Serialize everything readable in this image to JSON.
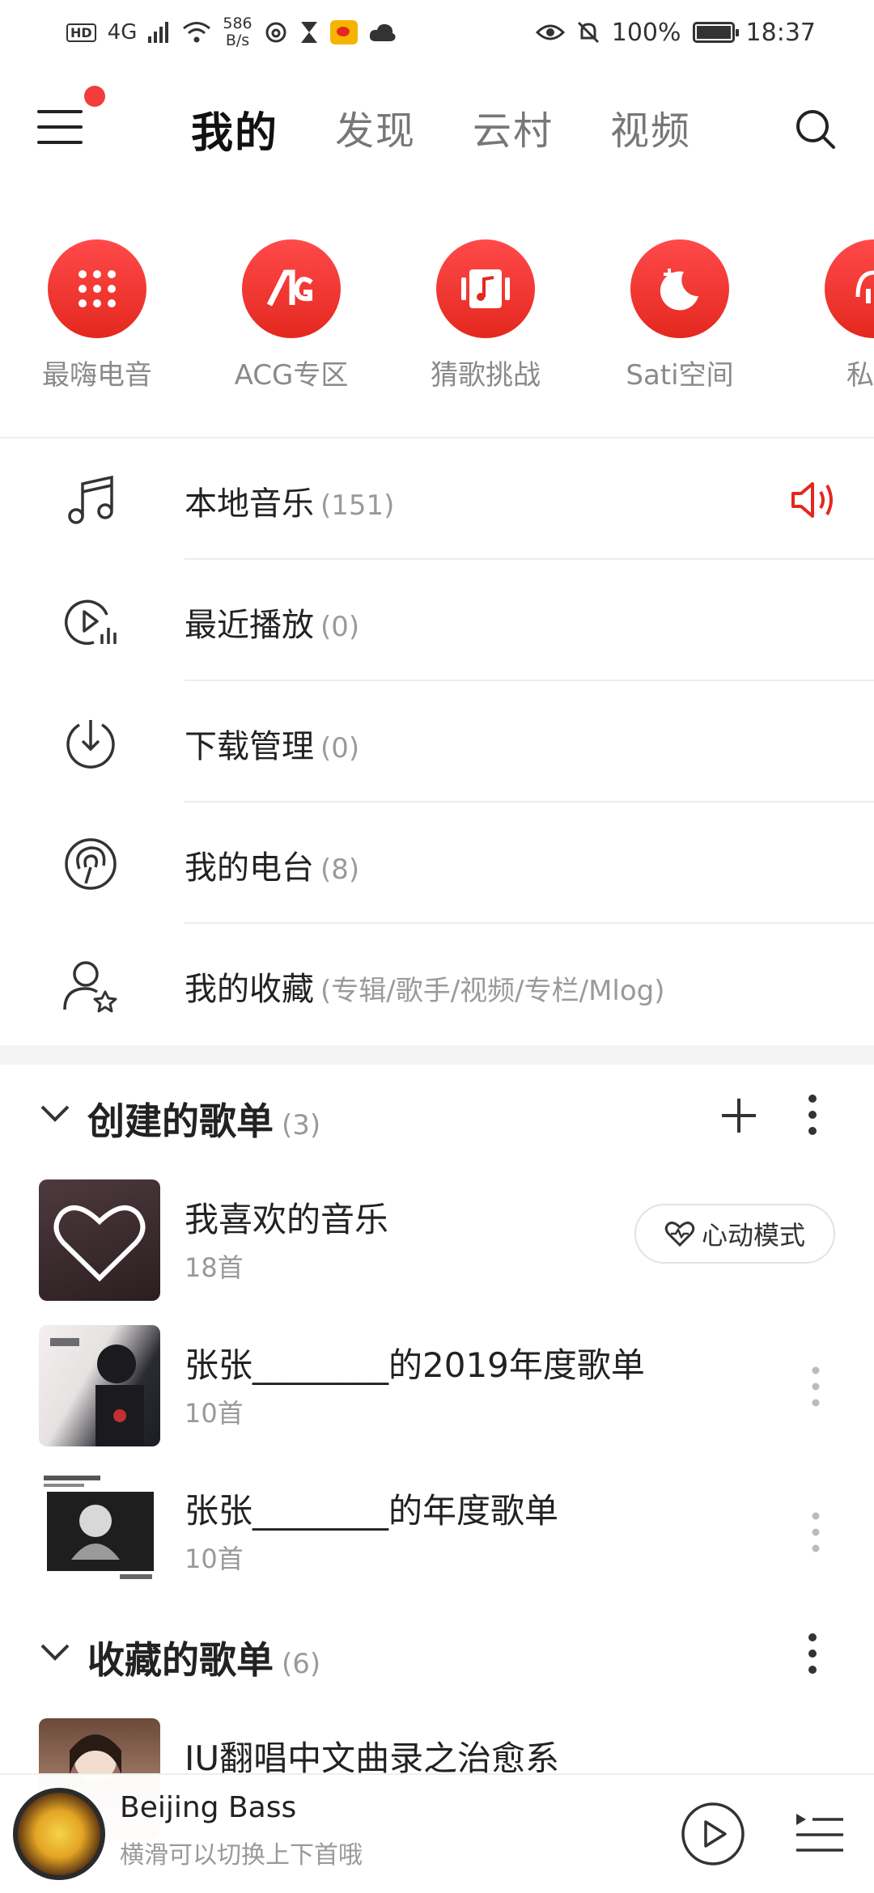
{
  "status_bar": {
    "network": "4G",
    "speed_value": "586",
    "speed_unit": "B/s",
    "battery": "100%",
    "battery_level": 1.0,
    "time": "18:37"
  },
  "nav": {
    "tabs": [
      {
        "label": "我的",
        "active": true
      },
      {
        "label": "发现",
        "active": false
      },
      {
        "label": "云村",
        "active": false
      },
      {
        "label": "视频",
        "active": false
      }
    ]
  },
  "quick_entries": [
    {
      "label": "最嗨电音",
      "icon": "dots-grid-icon"
    },
    {
      "label": "ACG专区",
      "icon": "acg-logo-icon"
    },
    {
      "label": "猜歌挑战",
      "icon": "music-card-icon"
    },
    {
      "label": "Sati空间",
      "icon": "moon-icon"
    },
    {
      "label": "私藏",
      "icon": "private-radio-icon"
    }
  ],
  "library": [
    {
      "label": "本地音乐",
      "count": "(151)",
      "icon": "music-note-icon"
    },
    {
      "label": "最近播放",
      "count": "(0)",
      "icon": "recent-play-icon"
    },
    {
      "label": "下载管理",
      "count": "(0)",
      "icon": "download-icon"
    },
    {
      "label": "我的电台",
      "count": "(8)",
      "icon": "radio-icon"
    },
    {
      "label": "我的收藏",
      "count": "(专辑/歌手/视频/专栏/Mlog)",
      "icon": "user-star-icon"
    }
  ],
  "created_section": {
    "title": "创建的歌单",
    "count": "(3)",
    "heart_mode_label": "心动模式",
    "playlists": [
      {
        "name": "我喜欢的音乐",
        "sub": "18首"
      },
      {
        "name": "张张________的2019年度歌单",
        "sub": "10首"
      },
      {
        "name": "张张________的年度歌单",
        "sub": "10首"
      }
    ]
  },
  "favorite_section": {
    "title": "收藏的歌单",
    "count": "(6)",
    "playlists": [
      {
        "name": "IU翻唱中文曲录之治愈系"
      }
    ]
  },
  "player": {
    "title": "Beijing Bass",
    "subtitle": "横滑可以切换上下首哦"
  },
  "colors": {
    "accent": "#e4281f",
    "text": "#222222",
    "muted": "#999999"
  }
}
